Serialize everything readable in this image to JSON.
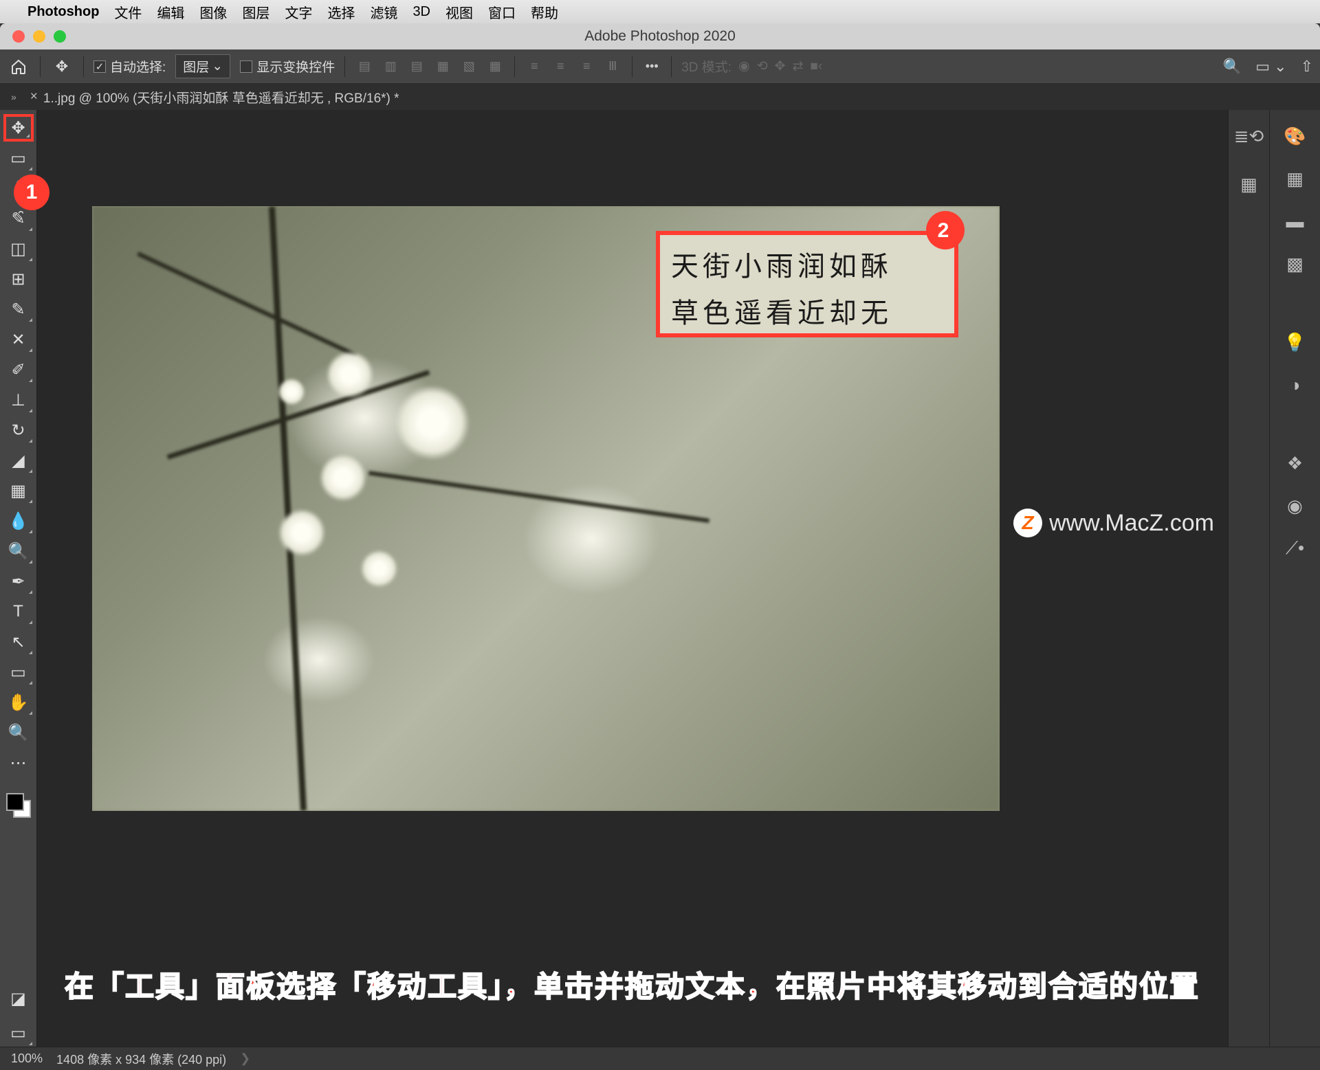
{
  "macos_menu": {
    "app": "Photoshop",
    "items": [
      "文件",
      "编辑",
      "图像",
      "图层",
      "文字",
      "选择",
      "滤镜",
      "3D",
      "视图",
      "窗口",
      "帮助"
    ]
  },
  "window": {
    "title": "Adobe Photoshop 2020"
  },
  "options_bar": {
    "auto_select_label": "自动选择:",
    "auto_select_checked": true,
    "target_dropdown": "图层",
    "show_transform_label": "显示变换控件",
    "show_transform_checked": false,
    "more_label": "•••",
    "mode_3d_label": "3D 模式:"
  },
  "doc_tab": {
    "close_glyph": "×",
    "title": "1..jpg @ 100% (天街小雨润如酥 草色遥看近却无  , RGB/16*) *"
  },
  "canvas_text": {
    "line1": "天街小雨润如酥",
    "line2": "草色遥看近却无"
  },
  "annotations": {
    "badge1": "1",
    "badge2": "2"
  },
  "watermark": {
    "logo": "Z",
    "text": "www.MacZ.com"
  },
  "status_bar": {
    "zoom": "100%",
    "doc_info": "1408 像素 x 934 像素 (240 ppi)",
    "arrow": "❯"
  },
  "instruction_text": "在「工具」面板选择「移动工具」，单击并拖动文本，在照片中将其移动到合适的位置",
  "colors": {
    "accent_red": "#ff3b30",
    "panel_bg": "#454545"
  }
}
